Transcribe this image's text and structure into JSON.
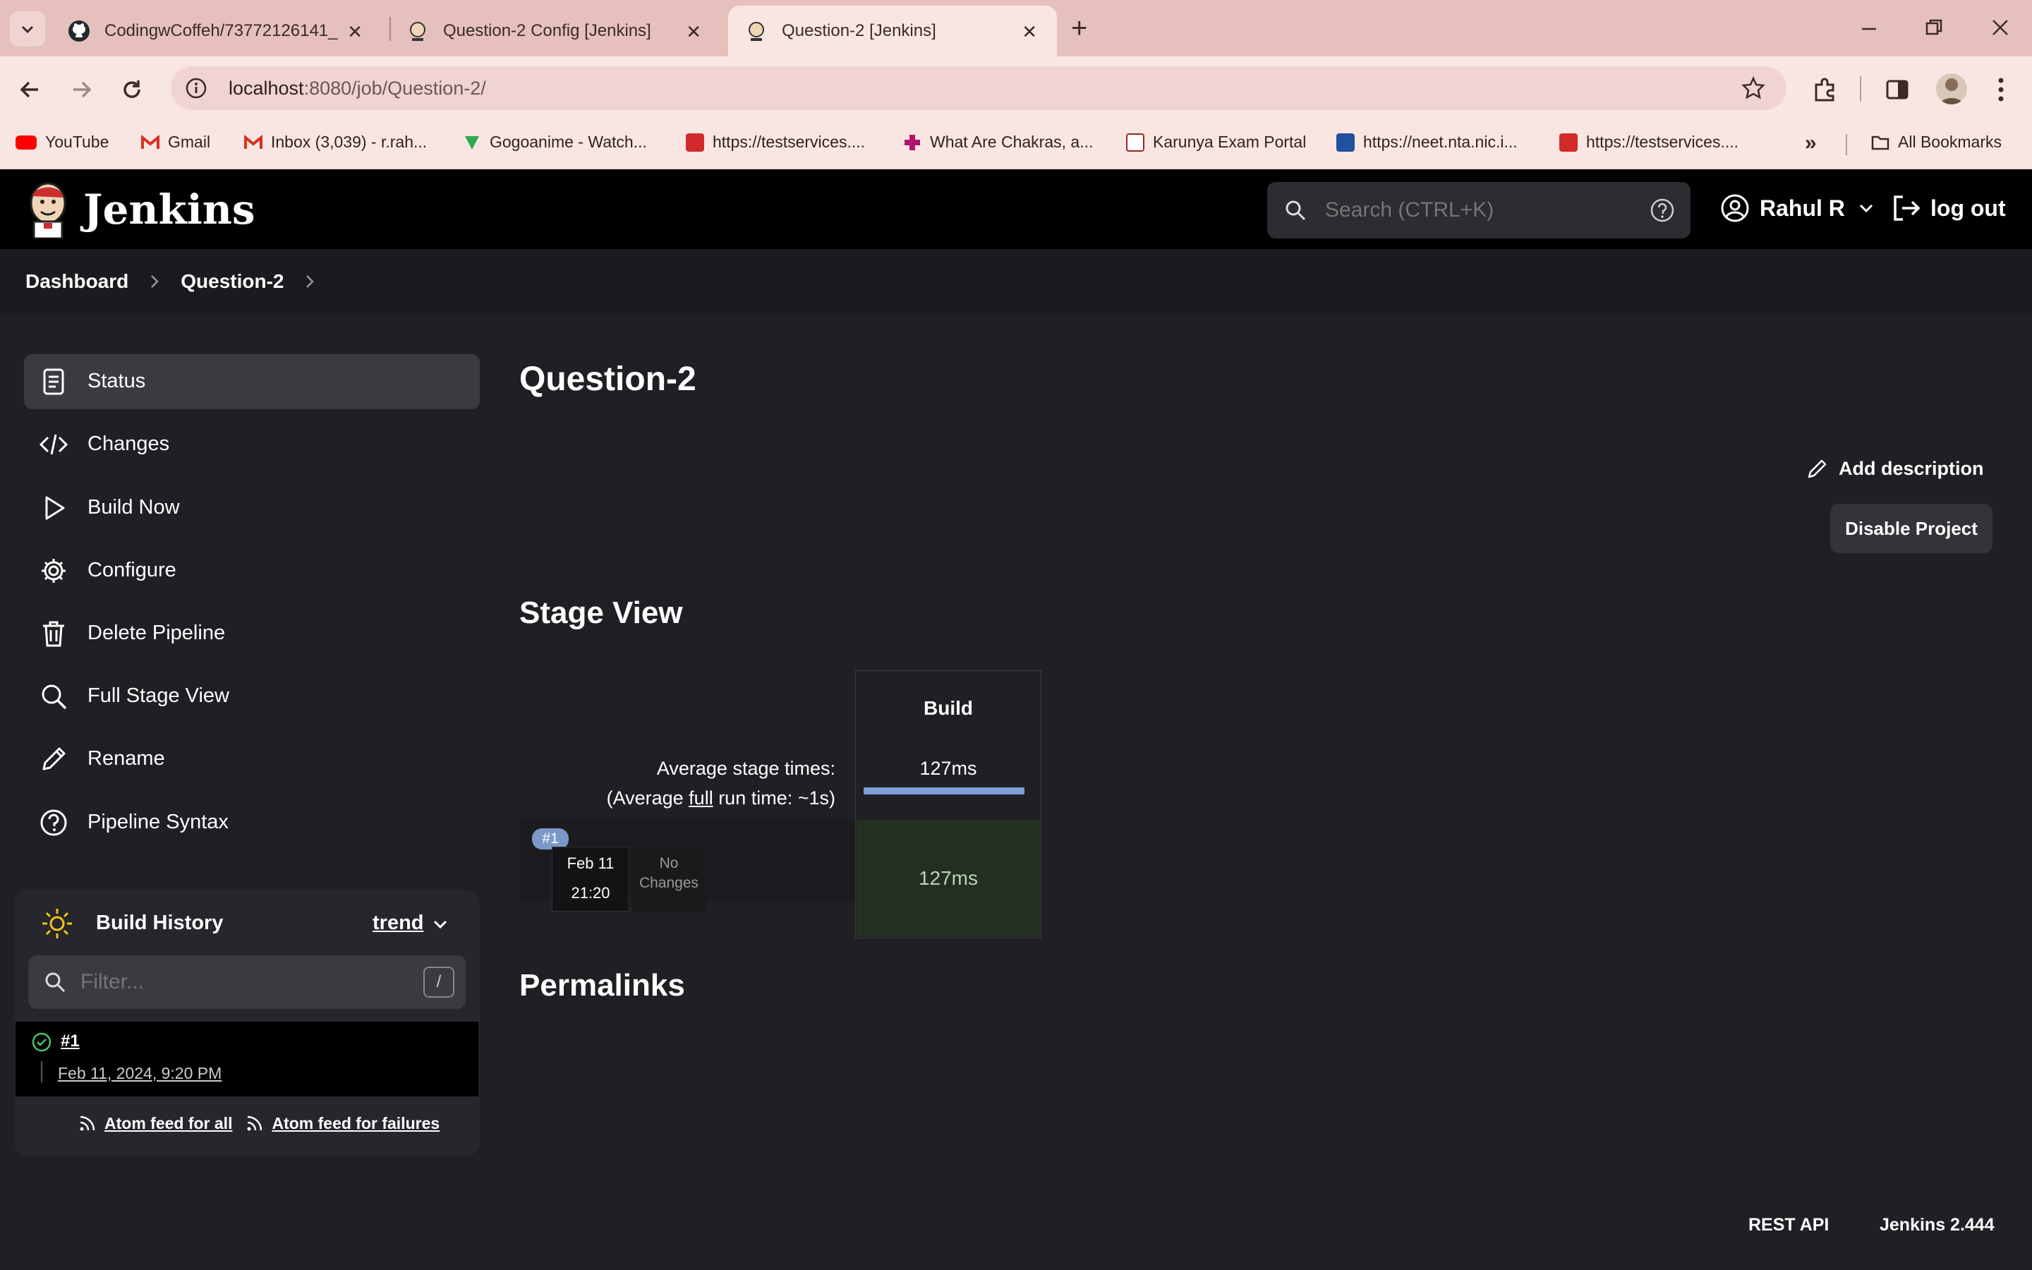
{
  "browser": {
    "tabs": [
      {
        "title": "CodingwCoffeh/73772126141_",
        "icon": "github-icon"
      },
      {
        "title": "Question-2 Config [Jenkins]",
        "icon": "jenkins-icon"
      },
      {
        "title": "Question-2 [Jenkins]",
        "icon": "jenkins-icon"
      }
    ],
    "url_host": "localhost",
    "url_rest": ":8080/job/Question-2/",
    "bookmarks": [
      {
        "label": "YouTube",
        "icon": "youtube-icon",
        "color": "#ff0000"
      },
      {
        "label": "Gmail",
        "icon": "gmail-icon",
        "color": "#d93025"
      },
      {
        "label": "Inbox (3,039) - r.rah...",
        "icon": "gmail-icon",
        "color": "#d93025"
      },
      {
        "label": "Gogoanime - Watch...",
        "icon": "gogoanime-icon",
        "color": "#2eaa4a"
      },
      {
        "label": "https://testservices....",
        "icon": "testservices-icon",
        "color": "#d22a2a"
      },
      {
        "label": "What Are Chakras, a...",
        "icon": "plus-icon",
        "color": "#b0156a"
      },
      {
        "label": "Karunya Exam Portal",
        "icon": "karunya-icon",
        "color": "#a02020"
      },
      {
        "label": "https://neet.nta.nic.i...",
        "icon": "nic-icon",
        "color": "#2050a0"
      },
      {
        "label": "https://testservices....",
        "icon": "testservices-icon",
        "color": "#d22a2a"
      }
    ],
    "all_bookmarks": "All Bookmarks"
  },
  "header": {
    "logo_text": "Jenkins",
    "search_placeholder": "Search (CTRL+K)",
    "user": "Rahul R",
    "logout": "log out"
  },
  "breadcrumb": [
    "Dashboard",
    "Question-2"
  ],
  "sidebar": {
    "items": [
      {
        "label": "Status",
        "icon": "status-icon"
      },
      {
        "label": "Changes",
        "icon": "code-icon"
      },
      {
        "label": "Build Now",
        "icon": "play-icon"
      },
      {
        "label": "Configure",
        "icon": "gear-icon"
      },
      {
        "label": "Delete Pipeline",
        "icon": "trash-icon"
      },
      {
        "label": "Full Stage View",
        "icon": "search-icon"
      },
      {
        "label": "Rename",
        "icon": "pencil-icon"
      },
      {
        "label": "Pipeline Syntax",
        "icon": "help-icon"
      }
    ]
  },
  "build_history": {
    "title": "Build History",
    "trend": "trend",
    "filter_placeholder": "Filter...",
    "filter_shortcut": "/",
    "builds": [
      {
        "number": "#1",
        "date": "Feb 11, 2024, 9:20 PM",
        "status": "success"
      }
    ],
    "feed_all": "Atom feed for all",
    "feed_failures": "Atom feed for failures"
  },
  "main": {
    "title": "Question-2",
    "add_description": "Add description",
    "disable_project": "Disable Project",
    "stage_view_title": "Stage View",
    "avg_label": "Average stage times:",
    "avg_run_prefix": "(Average ",
    "avg_run_full": "full",
    "avg_run_suffix": " run time: ~1s)",
    "stage_name": "Build",
    "stage_avg": "127ms",
    "run": {
      "badge": "#1",
      "date": "Feb 11",
      "time": "21:20",
      "changes": "No Changes",
      "duration": "127ms"
    },
    "permalinks_title": "Permalinks"
  },
  "footer": {
    "rest_api": "REST API",
    "version": "Jenkins 2.444"
  }
}
